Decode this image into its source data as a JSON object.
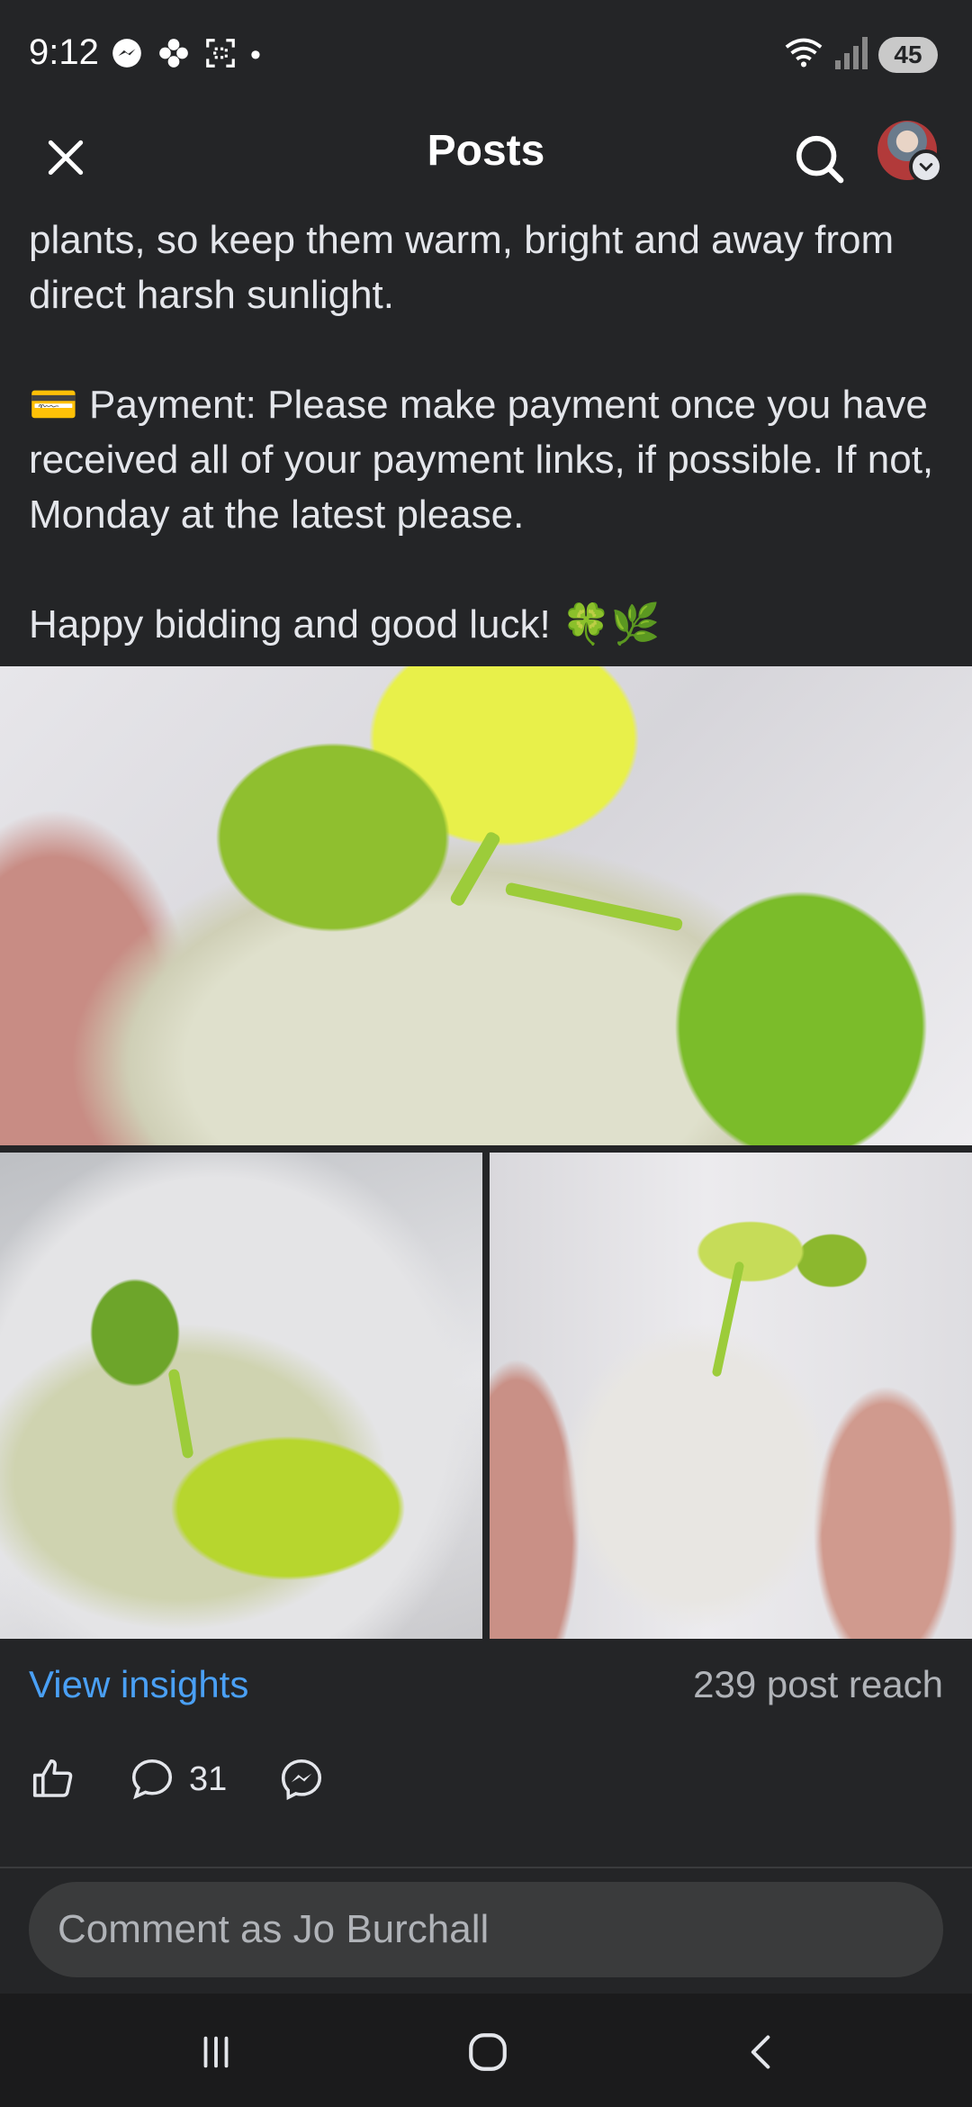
{
  "status_bar": {
    "time": "9:12",
    "dot": "•",
    "battery": "45",
    "icons": [
      "messenger-icon",
      "pinwheel-icon",
      "screenshot-icon",
      "wifi-icon",
      "signal-icon"
    ]
  },
  "header": {
    "title": "Posts",
    "icons": [
      "close-icon",
      "search-icon"
    ]
  },
  "post": {
    "paragraphs": [
      "plants, so keep them warm, bright and away from direct harsh sunlight.",
      "💳 Payment: Please make payment once you have received all of your payment links, if possible. If not, Monday at the latest please.",
      "Happy bidding and good luck! 🍀🌿"
    ]
  },
  "insights": {
    "view_label": "View insights",
    "reach": "239 post reach"
  },
  "actions": {
    "comment_count": "31",
    "icons": [
      "like-icon",
      "comment-icon",
      "messenger-share-icon"
    ]
  },
  "comment_box": {
    "placeholder": "Comment as Jo Burchall"
  },
  "colors": {
    "background": "#242527",
    "link": "#4aa0f5",
    "muted_text": "#b0b3b8"
  }
}
